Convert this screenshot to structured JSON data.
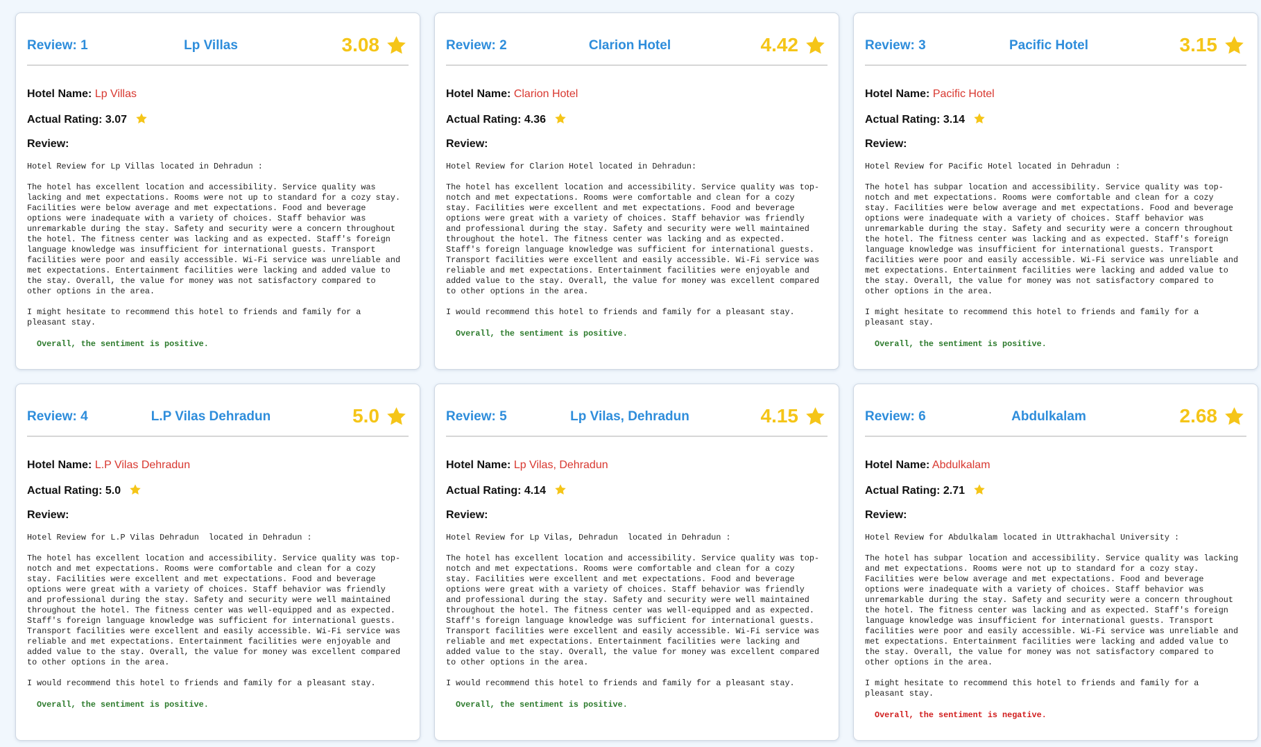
{
  "colors": {
    "accent_blue": "#2e8ddb",
    "star_yellow": "#f5c518",
    "hotel_name_red": "#d8372f",
    "positive_green": "#2c7a2c",
    "negative_red": "#d01c1c"
  },
  "labels": {
    "hotel_name": "Hotel Name:",
    "actual_rating": "Actual Rating:",
    "review": "Review:"
  },
  "cards": [
    {
      "review_label": "Review: 1",
      "title": "Lp Villas",
      "predicted_rating": "3.08",
      "hotel_name": "Lp Villas",
      "actual_rating": "3.07",
      "review_text": "Hotel Review for Lp Villas located in Dehradun :\n\nThe hotel has excellent location and accessibility. Service quality was\nlacking and met expectations. Rooms were not up to standard for a cozy stay.\nFacilities were below average and met expectations. Food and beverage\noptions were inadequate with a variety of choices. Staff behavior was\nunremarkable during the stay. Safety and security were a concern throughout\nthe hotel. The fitness center was lacking and as expected. Staff's foreign\nlanguage knowledge was insufficient for international guests. Transport\nfacilities were poor and easily accessible. Wi-Fi service was unreliable and\nmet expectations. Entertainment facilities were lacking and added value to\nthe stay. Overall, the value for money was not satisfactory compared to\nother options in the area.\n\nI might hesitate to recommend this hotel to friends and family for a\npleasant stay.",
      "sentiment": "Overall, the sentiment is positive.",
      "sentiment_type": "positive"
    },
    {
      "review_label": "Review: 2",
      "title": "Clarion Hotel",
      "predicted_rating": "4.42",
      "hotel_name": "Clarion Hotel",
      "actual_rating": "4.36",
      "review_text": "Hotel Review for Clarion Hotel located in Dehradun:\n\nThe hotel has excellent location and accessibility. Service quality was top-\nnotch and met expectations. Rooms were comfortable and clean for a cozy\nstay. Facilities were excellent and met expectations. Food and beverage\noptions were great with a variety of choices. Staff behavior was friendly\nand professional during the stay. Safety and security were well maintained\nthroughout the hotel. The fitness center was lacking and as expected.\nStaff's foreign language knowledge was sufficient for international guests.\nTransport facilities were excellent and easily accessible. Wi-Fi service was\nreliable and met expectations. Entertainment facilities were enjoyable and\nadded value to the stay. Overall, the value for money was excellent compared\nto other options in the area.\n\nI would recommend this hotel to friends and family for a pleasant stay.",
      "sentiment": "Overall, the sentiment is positive.",
      "sentiment_type": "positive"
    },
    {
      "review_label": "Review: 3",
      "title": "Pacific Hotel",
      "predicted_rating": "3.15",
      "hotel_name": "Pacific Hotel",
      "actual_rating": "3.14",
      "review_text": "Hotel Review for Pacific Hotel located in Dehradun :\n\nThe hotel has subpar location and accessibility. Service quality was top-\nnotch and met expectations. Rooms were comfortable and clean for a cozy\nstay. Facilities were below average and met expectations. Food and beverage\noptions were inadequate with a variety of choices. Staff behavior was\nunremarkable during the stay. Safety and security were a concern throughout\nthe hotel. The fitness center was lacking and as expected. Staff's foreign\nlanguage knowledge was insufficient for international guests. Transport\nfacilities were poor and easily accessible. Wi-Fi service was unreliable and\nmet expectations. Entertainment facilities were lacking and added value to\nthe stay. Overall, the value for money was not satisfactory compared to\nother options in the area.\n\nI might hesitate to recommend this hotel to friends and family for a\npleasant stay.",
      "sentiment": "Overall, the sentiment is positive.",
      "sentiment_type": "positive"
    },
    {
      "review_label": "Review: 4",
      "title": "L.P Vilas Dehradun",
      "predicted_rating": "5.0",
      "hotel_name": "L.P Vilas Dehradun",
      "actual_rating": "5.0",
      "review_text": "Hotel Review for L.P Vilas Dehradun  located in Dehradun :\n\nThe hotel has excellent location and accessibility. Service quality was top-\nnotch and met expectations. Rooms were comfortable and clean for a cozy\nstay. Facilities were excellent and met expectations. Food and beverage\noptions were great with a variety of choices. Staff behavior was friendly\nand professional during the stay. Safety and security were well maintained\nthroughout the hotel. The fitness center was well-equipped and as expected.\nStaff's foreign language knowledge was sufficient for international guests.\nTransport facilities were excellent and easily accessible. Wi-Fi service was\nreliable and met expectations. Entertainment facilities were enjoyable and\nadded value to the stay. Overall, the value for money was excellent compared\nto other options in the area.\n\nI would recommend this hotel to friends and family for a pleasant stay.",
      "sentiment": "Overall, the sentiment is positive.",
      "sentiment_type": "positive"
    },
    {
      "review_label": "Review: 5",
      "title": "Lp Vilas, Dehradun",
      "predicted_rating": "4.15",
      "hotel_name": "Lp Vilas, Dehradun",
      "actual_rating": "4.14",
      "review_text": "Hotel Review for Lp Vilas, Dehradun  located in Dehradun :\n\nThe hotel has excellent location and accessibility. Service quality was top-\nnotch and met expectations. Rooms were comfortable and clean for a cozy\nstay. Facilities were excellent and met expectations. Food and beverage\noptions were great with a variety of choices. Staff behavior was friendly\nand professional during the stay. Safety and security were well maintained\nthroughout the hotel. The fitness center was well-equipped and as expected.\nStaff's foreign language knowledge was sufficient for international guests.\nTransport facilities were excellent and easily accessible. Wi-Fi service was\nreliable and met expectations. Entertainment facilities were lacking and\nadded value to the stay. Overall, the value for money was excellent compared\nto other options in the area.\n\nI would recommend this hotel to friends and family for a pleasant stay.",
      "sentiment": "Overall, the sentiment is positive.",
      "sentiment_type": "positive"
    },
    {
      "review_label": "Review: 6",
      "title": "Abdulkalam",
      "predicted_rating": "2.68",
      "hotel_name": "Abdulkalam",
      "actual_rating": "2.71",
      "review_text": "Hotel Review for Abdulkalam located in Uttrakhachal University :\n\nThe hotel has subpar location and accessibility. Service quality was lacking\nand met expectations. Rooms were not up to standard for a cozy stay.\nFacilities were below average and met expectations. Food and beverage\noptions were inadequate with a variety of choices. Staff behavior was\nunremarkable during the stay. Safety and security were a concern throughout\nthe hotel. The fitness center was lacking and as expected. Staff's foreign\nlanguage knowledge was insufficient for international guests. Transport\nfacilities were poor and easily accessible. Wi-Fi service was unreliable and\nmet expectations. Entertainment facilities were lacking and added value to\nthe stay. Overall, the value for money was not satisfactory compared to\nother options in the area.\n\nI might hesitate to recommend this hotel to friends and family for a\npleasant stay.",
      "sentiment": "Overall, the sentiment is negative.",
      "sentiment_type": "negative"
    }
  ]
}
